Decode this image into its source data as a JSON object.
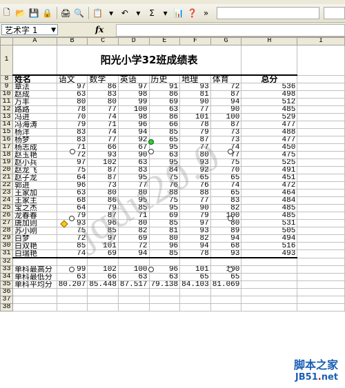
{
  "name_box": "艺术字 1",
  "fx_label": "fx",
  "columns": [
    "A",
    "B",
    "C",
    "D",
    "E",
    "F",
    "G",
    "H",
    "I"
  ],
  "title": "阳光小学32班成绩表",
  "header": [
    "姓名",
    "语文",
    "数学",
    "英语",
    "历史",
    "地理",
    "体育",
    "总分"
  ],
  "students": [
    {
      "row": "9",
      "name": "章法",
      "v": [
        "97",
        "86",
        "97",
        "91",
        "93",
        "72",
        "536"
      ]
    },
    {
      "row": "10",
      "name": "赵成",
      "v": [
        "63",
        "83",
        "98",
        "86",
        "81",
        "87",
        "498"
      ]
    },
    {
      "row": "11",
      "name": "万丰",
      "v": [
        "80",
        "80",
        "99",
        "69",
        "90",
        "94",
        "512"
      ]
    },
    {
      "row": "12",
      "name": "路路",
      "v": [
        "78",
        "77",
        "100",
        "63",
        "77",
        "90",
        "485"
      ]
    },
    {
      "row": "13",
      "name": "冯进",
      "v": [
        "70",
        "74",
        "98",
        "86",
        "101",
        "100",
        "529"
      ]
    },
    {
      "row": "14",
      "name": "冯海涛",
      "v": [
        "79",
        "71",
        "96",
        "66",
        "78",
        "87",
        "477"
      ]
    },
    {
      "row": "15",
      "name": "杨洋",
      "v": [
        "83",
        "74",
        "94",
        "85",
        "79",
        "73",
        "488"
      ]
    },
    {
      "row": "16",
      "name": "杨梦",
      "v": [
        "83",
        "77",
        "92",
        "65",
        "87",
        "73",
        "477"
      ]
    },
    {
      "row": "17",
      "name": "杨志成",
      "v": [
        "71",
        "66",
        "67",
        "95",
        "77",
        "74",
        "450"
      ]
    },
    {
      "row": "18",
      "name": "赵玉艳",
      "v": [
        "72",
        "93",
        "90",
        "63",
        "80",
        "77",
        "475"
      ]
    },
    {
      "row": "19",
      "name": "赵小兵",
      "v": [
        "97",
        "102",
        "63",
        "95",
        "93",
        "75",
        "525"
      ]
    },
    {
      "row": "20",
      "name": "赵龙飞",
      "v": [
        "75",
        "87",
        "83",
        "84",
        "92",
        "70",
        "491"
      ]
    },
    {
      "row": "21",
      "name": "赵子龙",
      "v": [
        "64",
        "87",
        "95",
        "75",
        "65",
        "65",
        "451"
      ]
    },
    {
      "row": "22",
      "name": "郭进",
      "v": [
        "96",
        "73",
        "77",
        "76",
        "76",
        "74",
        "472"
      ]
    },
    {
      "row": "23",
      "name": "王家加",
      "v": [
        "63",
        "80",
        "80",
        "88",
        "88",
        "65",
        "464"
      ]
    },
    {
      "row": "24",
      "name": "王家主",
      "v": [
        "68",
        "86",
        "95",
        "75",
        "77",
        "83",
        "484"
      ]
    },
    {
      "row": "25",
      "name": "宝之杰",
      "v": [
        "64",
        "79",
        "85",
        "95",
        "90",
        "82",
        "485"
      ]
    },
    {
      "row": "26",
      "name": "龙春春",
      "v": [
        "79",
        "87",
        "71",
        "69",
        "79",
        "100",
        "485"
      ]
    },
    {
      "row": "27",
      "name": "唐加则",
      "v": [
        "93",
        "96",
        "80",
        "85",
        "97",
        "80",
        "531"
      ]
    },
    {
      "row": "28",
      "name": "苏小刚",
      "v": [
        "75",
        "85",
        "82",
        "81",
        "93",
        "89",
        "505"
      ]
    },
    {
      "row": "29",
      "name": "白梦",
      "v": [
        "72",
        "97",
        "69",
        "80",
        "82",
        "94",
        "494"
      ]
    },
    {
      "row": "30",
      "name": "白双艳",
      "v": [
        "85",
        "101",
        "72",
        "96",
        "94",
        "68",
        "516"
      ]
    },
    {
      "row": "31",
      "name": "白瑞艳",
      "v": [
        "74",
        "69",
        "94",
        "85",
        "78",
        "93",
        "493"
      ]
    }
  ],
  "stats": [
    {
      "row": "33",
      "label": "单科最高分",
      "v": [
        "99",
        "102",
        "100",
        "96",
        "101",
        "100"
      ]
    },
    {
      "row": "34",
      "label": "单科最低分",
      "v": [
        "63",
        "66",
        "63",
        "63",
        "65",
        "65"
      ]
    },
    {
      "row": "35",
      "label": "单科平均分",
      "v": [
        "80.207",
        "85.448",
        "87.517",
        "79.138",
        "84.103",
        "81.069"
      ]
    }
  ],
  "watermark_text": "jgdu20.0",
  "logo": {
    "line1": "脚本之家",
    "line2_blue": "JB51",
    "line2_dot": ".",
    "line2_net": "net"
  }
}
